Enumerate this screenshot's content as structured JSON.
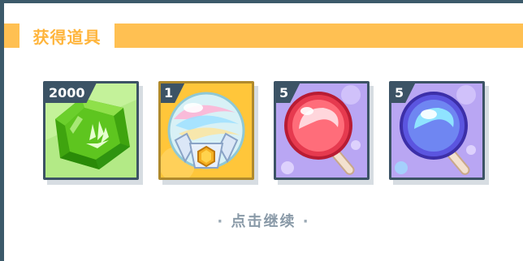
{
  "dialog": {
    "title": "获得道具"
  },
  "items": [
    {
      "count": "2000",
      "icon": "green-gem-icon",
      "bg": "#b8ee8a"
    },
    {
      "count": "1",
      "icon": "crystal-orb-chest-icon",
      "bg": "#ffc63a"
    },
    {
      "count": "5",
      "icon": "red-lollipop-icon",
      "bg": "#b9a6f3"
    },
    {
      "count": "5",
      "icon": "blue-lollipop-icon",
      "bg": "#b9a6f3"
    }
  ],
  "footer": {
    "dot_left": "·",
    "continue_label": "点击继续",
    "dot_right": "·"
  },
  "colors": {
    "title_accent": "#ffc052",
    "frame": "#3c5365",
    "hint_text": "#8a9aa8"
  }
}
